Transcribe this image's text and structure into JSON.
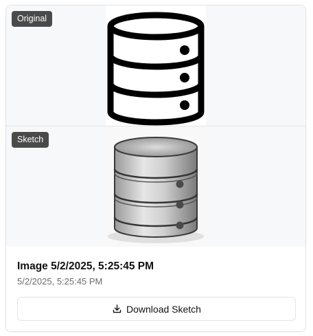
{
  "original_panel": {
    "badge": "Original",
    "icon": "database-icon"
  },
  "sketch_panel": {
    "badge": "Sketch",
    "icon": "database-sketch-icon"
  },
  "info": {
    "title": "Image 5/2/2025, 5:25:45 PM",
    "timestamp": "5/2/2025, 5:25:45 PM"
  },
  "download": {
    "label": "Download Sketch",
    "icon": "download-icon"
  }
}
